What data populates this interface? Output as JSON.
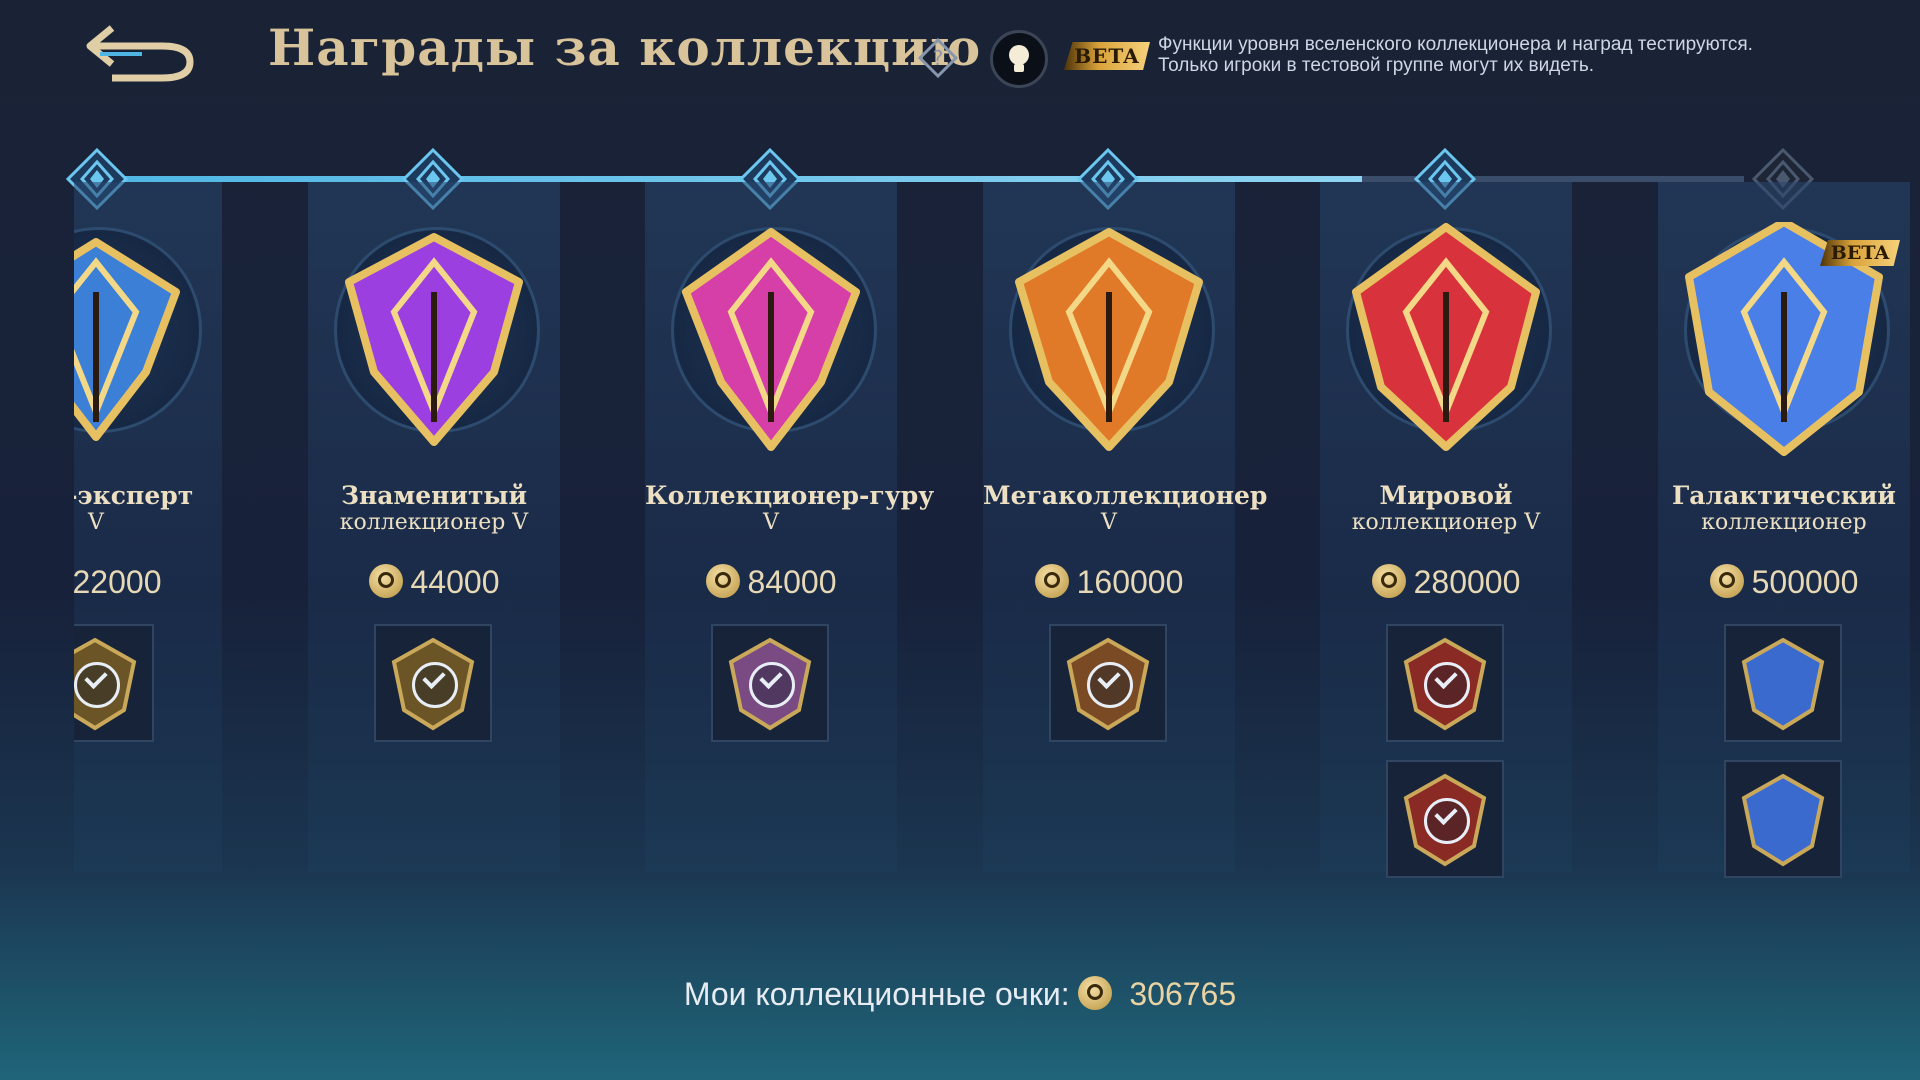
{
  "header": {
    "title": "Награды за коллекцию",
    "beta_label": "BETA",
    "beta_note_line1": "Функции уровня вселенского коллекционера и наград тестируются.",
    "beta_note_line2": "Только игроки в тестовой группе могут их видеть."
  },
  "tiers": [
    {
      "name": "онер-эксперт",
      "sub": "V",
      "points": "22000",
      "rewards": [
        "claimed"
      ]
    },
    {
      "name": "Знаменитый",
      "sub": "коллекционер V",
      "points": "44000",
      "rewards": [
        "claimed"
      ]
    },
    {
      "name": "Коллекционер-гуру",
      "sub": "V",
      "points": "84000",
      "rewards": [
        "claimed"
      ]
    },
    {
      "name": "Мегаколлекционер",
      "sub": "V",
      "points": "160000",
      "rewards": [
        "claimed"
      ]
    },
    {
      "name": "Мировой",
      "sub": "коллекционер V",
      "points": "280000",
      "rewards": [
        "claimed",
        "claimed"
      ]
    },
    {
      "name": "Галактический",
      "sub": "коллекционер",
      "points": "500000",
      "rewards": [
        "locked",
        "locked"
      ],
      "beta_label": "BETA"
    }
  ],
  "footer": {
    "label": "Мои коллекционные очки:",
    "points": "306765"
  },
  "progress": {
    "reached_tiers": 5,
    "total_tiers": 6
  },
  "colors": {
    "gold_text": "#d8c39a",
    "track_fill": "#4fb6e4",
    "emblem_1": "#3b7fd6",
    "emblem_2": "#9b3fe0",
    "emblem_3": "#d63ea8",
    "emblem_4": "#e07a28",
    "emblem_5": "#d8333c",
    "emblem_6": "#4a7fe8"
  }
}
